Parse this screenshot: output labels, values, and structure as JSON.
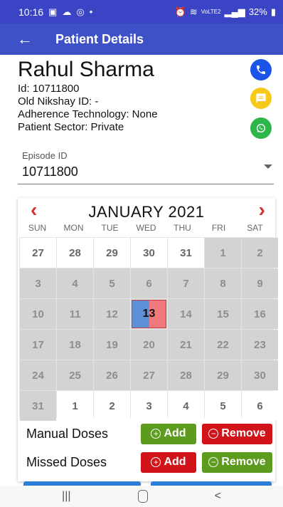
{
  "status_bar": {
    "time": "10:16",
    "left_icons": [
      "gallery-icon",
      "cloud-icon",
      "instagram-icon",
      "dot-icon"
    ],
    "right_icons": [
      "alarm-icon",
      "wifi-icon",
      "volte-icon",
      "signal-icon",
      "battery-icon"
    ],
    "volte": "VoLTE2",
    "battery": "32%"
  },
  "app_bar": {
    "title": "Patient Details"
  },
  "patient": {
    "name": "Rahul Sharma",
    "id_line": "Id: 10711800",
    "nikshay_line": "Old Nikshay ID: -",
    "adherence_line": "Adherence Technology: None",
    "sector_line": "Patient Sector: Private"
  },
  "episode": {
    "label": "Episode ID",
    "value": "10711800"
  },
  "calendar": {
    "month": "JANUARY 2021",
    "prev": "‹",
    "next": "›",
    "weekdays": [
      "SUN",
      "MON",
      "TUE",
      "WED",
      "THU",
      "FRI",
      "SAT"
    ],
    "days": [
      {
        "n": "27",
        "t": "white"
      },
      {
        "n": "28",
        "t": "white"
      },
      {
        "n": "29",
        "t": "white"
      },
      {
        "n": "30",
        "t": "white"
      },
      {
        "n": "31",
        "t": "white"
      },
      {
        "n": "1",
        "t": "gray"
      },
      {
        "n": "2",
        "t": "gray"
      },
      {
        "n": "3",
        "t": "gray"
      },
      {
        "n": "4",
        "t": "gray"
      },
      {
        "n": "5",
        "t": "gray"
      },
      {
        "n": "6",
        "t": "gray"
      },
      {
        "n": "7",
        "t": "gray"
      },
      {
        "n": "8",
        "t": "gray"
      },
      {
        "n": "9",
        "t": "gray"
      },
      {
        "n": "10",
        "t": "gray"
      },
      {
        "n": "11",
        "t": "gray"
      },
      {
        "n": "12",
        "t": "gray"
      },
      {
        "n": "13",
        "t": "today"
      },
      {
        "n": "14",
        "t": "gray"
      },
      {
        "n": "15",
        "t": "gray"
      },
      {
        "n": "16",
        "t": "gray"
      },
      {
        "n": "17",
        "t": "gray"
      },
      {
        "n": "18",
        "t": "gray"
      },
      {
        "n": "19",
        "t": "gray"
      },
      {
        "n": "20",
        "t": "gray"
      },
      {
        "n": "21",
        "t": "gray"
      },
      {
        "n": "22",
        "t": "gray"
      },
      {
        "n": "23",
        "t": "gray"
      },
      {
        "n": "24",
        "t": "gray"
      },
      {
        "n": "25",
        "t": "gray"
      },
      {
        "n": "26",
        "t": "gray"
      },
      {
        "n": "27",
        "t": "gray"
      },
      {
        "n": "28",
        "t": "gray"
      },
      {
        "n": "29",
        "t": "gray"
      },
      {
        "n": "30",
        "t": "gray"
      },
      {
        "n": "31",
        "t": "gray"
      },
      {
        "n": "1",
        "t": "white"
      },
      {
        "n": "2",
        "t": "white"
      },
      {
        "n": "3",
        "t": "white"
      },
      {
        "n": "4",
        "t": "white"
      },
      {
        "n": "5",
        "t": "white"
      },
      {
        "n": "6",
        "t": "white"
      }
    ]
  },
  "doses": {
    "manual": {
      "label": "Manual Doses",
      "add": "Add",
      "remove": "Remove"
    },
    "missed": {
      "label": "Missed Doses",
      "add": "Add",
      "remove": "Remove"
    }
  },
  "colors": {
    "primary": "#3f51c6",
    "call": "#1a54e8",
    "sms": "#f6c817",
    "whatsapp": "#2fb64a",
    "nav_arrow": "#d32f2f",
    "green_button": "#5d9b1e",
    "red_button": "#d0141a",
    "today_left": "#5d8fd6",
    "today_right": "#f0797d"
  }
}
